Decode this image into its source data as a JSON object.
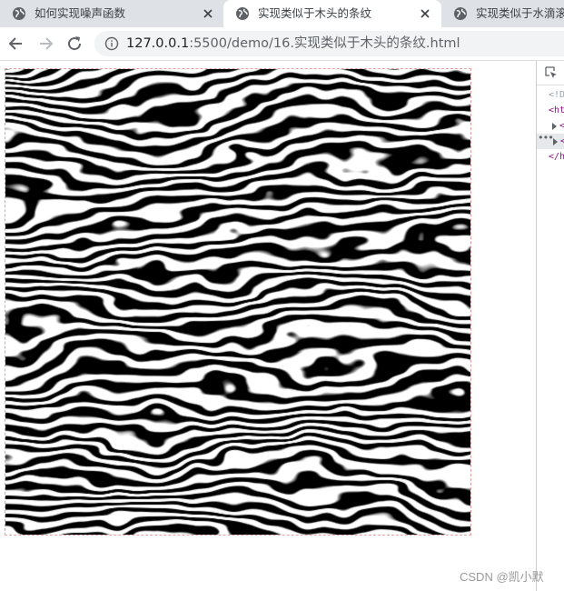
{
  "tabs": [
    {
      "title": "如何实现噪声函数",
      "active": false,
      "icon": "globe-icon",
      "closable": true
    },
    {
      "title": "实现类似于木头的条纹",
      "active": true,
      "icon": "globe-icon",
      "closable": true
    },
    {
      "title": "实现类似于水滴滚动",
      "active": false,
      "icon": "globe-icon",
      "closable": false
    }
  ],
  "toolbar": {
    "back_icon": "back-arrow-icon",
    "forward_icon": "forward-arrow-icon",
    "reload_icon": "reload-icon",
    "site_info_icon": "info-icon",
    "url_host": "127.0.0.1",
    "url_path": ":5500/demo/16.实现类似于木头的条纹.html"
  },
  "canvas": {
    "name": "wood-grain-noise-pattern",
    "colors": {
      "dark": "#000000",
      "light": "#ffffff"
    }
  },
  "devtools": {
    "inspect_icon": "inspect-element-icon",
    "lines": [
      "<!D",
      "<ht",
      "<",
      "<",
      "</h"
    ]
  },
  "watermark": "CSDN @凯小默",
  "colors": {
    "tabstrip": "#dee1e6",
    "omnibox": "#f1f3f4",
    "tag": "#881280"
  }
}
